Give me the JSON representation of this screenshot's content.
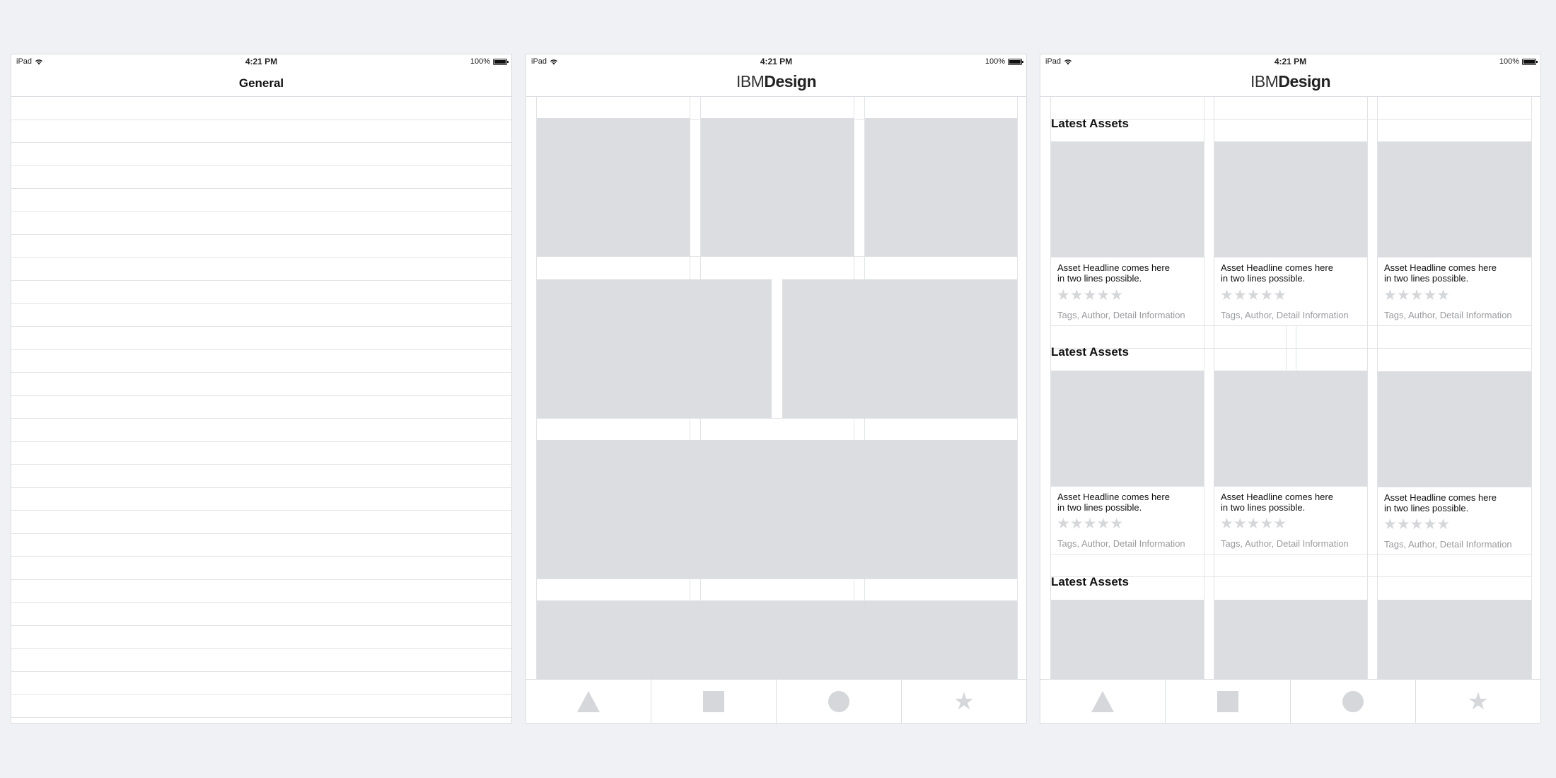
{
  "status": {
    "carrier": "iPad",
    "time": "4:21 PM",
    "battery": "100%",
    "battery_level": 1.0
  },
  "screen1": {
    "title": "General"
  },
  "brand": {
    "ibm": "IBM",
    "design": "Design"
  },
  "tabs": [
    {
      "icon": "triangle-icon"
    },
    {
      "icon": "square-icon"
    },
    {
      "icon": "circle-icon"
    },
    {
      "icon": "star-icon"
    }
  ],
  "sections": [
    {
      "title": "Latest Assets"
    },
    {
      "title": "Latest Assets"
    },
    {
      "title": "Latest Assets"
    }
  ],
  "card": {
    "headline_line1": "Asset Headline comes here",
    "headline_line2": "in two lines possible.",
    "rating": "★★★★★",
    "meta": "Tags, Author, Detail Information"
  }
}
